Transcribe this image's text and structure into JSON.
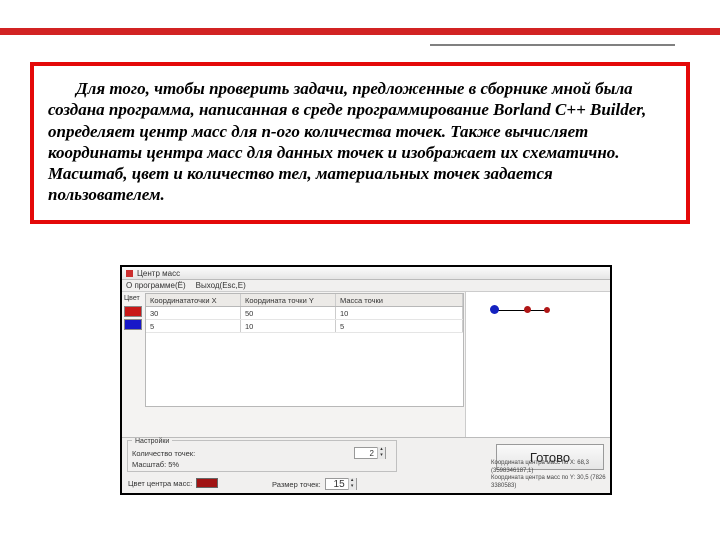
{
  "description_text": "Для того, чтобы проверить задачи, предложенные в сборнике мной была создана программа, написанная в среде программирование Borland C++ Builder, определяет центр масс для n-ого количества точек. Также вычисляет координаты центра масс для данных точек и изображает их схематично. Масштаб, цвет и количество тел, материальных точек задается пользователем.",
  "app": {
    "title": "Центр масс",
    "menu": {
      "program": "О программе(Ё)",
      "exit": "Выход(Esc,E)"
    },
    "left_label": "Цвет",
    "swatches": [
      "#c81818",
      "#1818c8"
    ],
    "grid": {
      "headers": {
        "x": "Координататочки X",
        "y": "Координата точки Y",
        "m": "Масса точки"
      },
      "rows": [
        {
          "x": "30",
          "y": "50",
          "m": "10"
        },
        {
          "x": "5",
          "y": "10",
          "m": "5"
        }
      ]
    },
    "canvas_points": [
      {
        "color": "#1522c0",
        "x": 24,
        "y": 14,
        "size": 9
      },
      {
        "color": "#b01616",
        "x": 58,
        "y": 14,
        "size": 7
      },
      {
        "color": "#b01616",
        "x": 78,
        "y": 15,
        "size": 6
      }
    ],
    "settings": {
      "legend": "Настройки",
      "count_label": "Количество точек:",
      "count_value": "2",
      "scale_label": "Масштаб: 5%",
      "center_color_label": "Цвет центра масс:",
      "center_color": "#a01313",
      "size_label": "Размер точек:",
      "size_value": "15"
    },
    "ready_label": "Готово",
    "output": {
      "line1": "Координата центра масс по Х: 68,3 (3598346187,1)",
      "line2": "Координата центра масс по Y: 30,5 (7826 3380583)"
    }
  }
}
